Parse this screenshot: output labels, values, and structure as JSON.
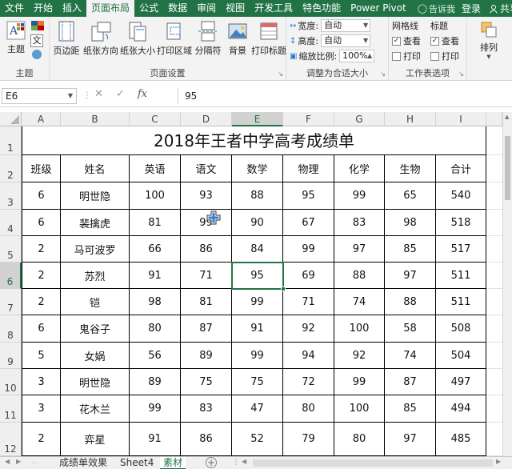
{
  "menu": {
    "tabs": [
      "文件",
      "开始",
      "插入",
      "页面布局",
      "公式",
      "数据",
      "审阅",
      "视图",
      "开发工具",
      "特色功能",
      "Power Pivot"
    ],
    "active_index": 3,
    "tell_me": "告诉我",
    "login": "登录",
    "share": "共享"
  },
  "ribbon": {
    "groups": {
      "theme": "主题",
      "page_setup": "页面设置",
      "scale_to_fit": "调整为合适大小",
      "sheet_options": "工作表选项"
    },
    "buttons": {
      "themes": "主题",
      "margins": "页边距",
      "orientation": "纸张方向",
      "size": "纸张大小",
      "print_area": "打印区域",
      "breaks": "分隔符",
      "background": "背景",
      "print_titles": "打印标题",
      "arrange": "排列",
      "theme_fonts": "文"
    },
    "scale": {
      "width_label": "宽度:",
      "width_value": "自动",
      "height_label": "高度:",
      "height_value": "自动",
      "scale_label": "缩放比例:",
      "scale_value": "100%"
    },
    "sheet_options": {
      "gridlines": "网格线",
      "headings": "标题",
      "view": "查看",
      "print": "打印"
    }
  },
  "formula_bar": {
    "name_box": "E6",
    "value": "95",
    "fx": "fx"
  },
  "columns": [
    "A",
    "B",
    "C",
    "D",
    "E",
    "F",
    "G",
    "H",
    "I"
  ],
  "rows": [
    "1",
    "2",
    "3",
    "4",
    "5",
    "6",
    "7",
    "8",
    "9",
    "10",
    "11",
    "12"
  ],
  "sheet": {
    "title": "2018年王者中学高考成绩单",
    "headers": [
      "班级",
      "姓名",
      "英语",
      "语文",
      "数学",
      "物理",
      "化学",
      "生物",
      "合计"
    ],
    "data": [
      [
        "6",
        "明世隐",
        "100",
        "93",
        "88",
        "95",
        "99",
        "65",
        "540"
      ],
      [
        "6",
        "裴擒虎",
        "81",
        "99",
        "90",
        "67",
        "83",
        "98",
        "518"
      ],
      [
        "2",
        "马可波罗",
        "66",
        "86",
        "84",
        "99",
        "97",
        "85",
        "517"
      ],
      [
        "2",
        "苏烈",
        "91",
        "71",
        "95",
        "69",
        "88",
        "97",
        "511"
      ],
      [
        "2",
        "铠",
        "98",
        "81",
        "99",
        "71",
        "74",
        "88",
        "511"
      ],
      [
        "6",
        "鬼谷子",
        "80",
        "87",
        "91",
        "92",
        "100",
        "58",
        "508"
      ],
      [
        "5",
        "女娲",
        "56",
        "89",
        "99",
        "94",
        "92",
        "74",
        "504"
      ],
      [
        "3",
        "明世隐",
        "89",
        "75",
        "75",
        "72",
        "99",
        "87",
        "497"
      ],
      [
        "3",
        "花木兰",
        "99",
        "83",
        "47",
        "80",
        "100",
        "85",
        "494"
      ],
      [
        "2",
        "弈星",
        "91",
        "86",
        "52",
        "79",
        "80",
        "97",
        "485"
      ]
    ]
  },
  "sheet_tabs": [
    "成绩单效果",
    "Sheet4",
    "素材"
  ],
  "active_sheet": 2,
  "colors": {
    "excel_green": "#217346",
    "ribbon_bg": "#f3f3f3"
  }
}
